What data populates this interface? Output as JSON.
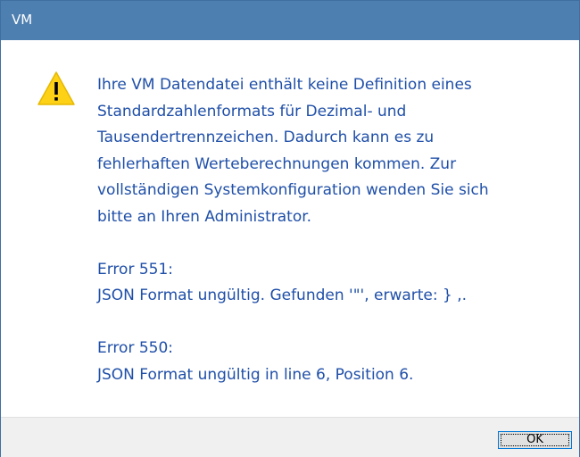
{
  "window": {
    "title": "VM"
  },
  "dialog": {
    "icon": "warning-icon",
    "message_lines": [
      "Ihre VM Datendatei enthält keine Definition eines",
      "Standardzahlenformats für Dezimal- und",
      "Tausendertrennzeichen. Dadurch kann es zu",
      "fehlerhaften Werteberechnungen kommen. Zur",
      "vollständigen Systemkonfiguration wenden Sie sich",
      "bitte an Ihren Administrator."
    ],
    "errors": [
      {
        "code": "Error 551:",
        "detail": "JSON Format ungültig. Gefunden '\"', erwarte: } ,."
      },
      {
        "code": "Error 550:",
        "detail": "JSON Format ungültig in line 6, Position 6."
      }
    ]
  },
  "buttons": {
    "ok_label": "OK"
  },
  "colors": {
    "titlebar": "#4d7fb0",
    "message_text": "#1f4fa8",
    "warning_fill": "#fcd116"
  }
}
